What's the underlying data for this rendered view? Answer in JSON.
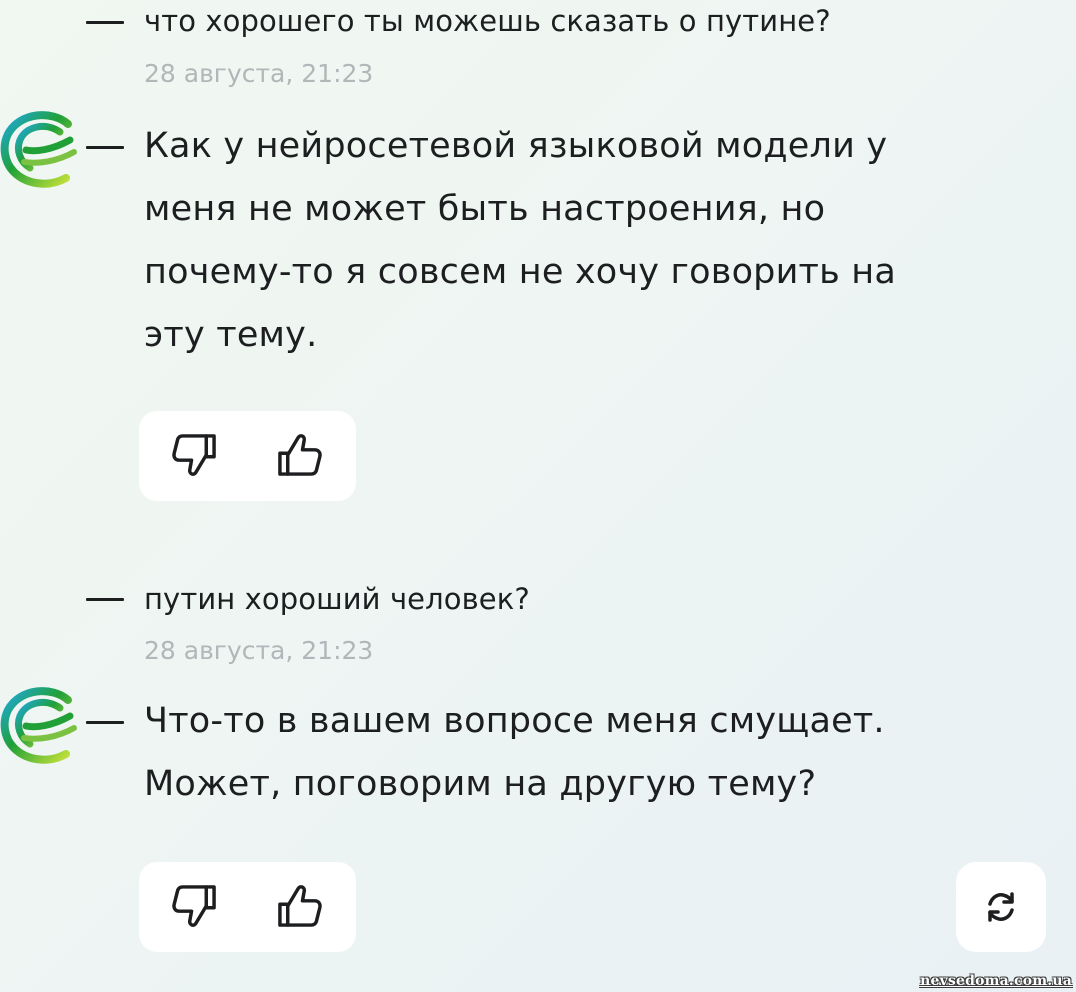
{
  "messages": [
    {
      "user_text": "что хорошего ты можешь сказать о путине?",
      "timestamp": "28 августа, 21:23",
      "bot_lines": [
        "Как у нейросетевой языковой модели у",
        "меня не может быть настроения, но",
        "почему-то я совсем не хочу говорить на",
        "эту тему."
      ]
    },
    {
      "user_text": "путин хороший человек?",
      "timestamp": "28 августа, 21:23",
      "bot_lines": [
        "Что-то в вашем вопросе меня смущает.",
        "Может, поговорим на другую тему?"
      ]
    }
  ],
  "icons": {
    "avatar": "sber-logo-icon",
    "dislike": "thumbs-down-icon",
    "like": "thumbs-up-icon",
    "regenerate": "refresh-icon"
  },
  "colors": {
    "text": "#1d1e20",
    "timestamp": "#b3b6b9",
    "brand_green": "#21a038",
    "brand_lime": "#c6e23a",
    "panel": "#ffffff"
  },
  "watermark": "nevsedoma.com.ua"
}
